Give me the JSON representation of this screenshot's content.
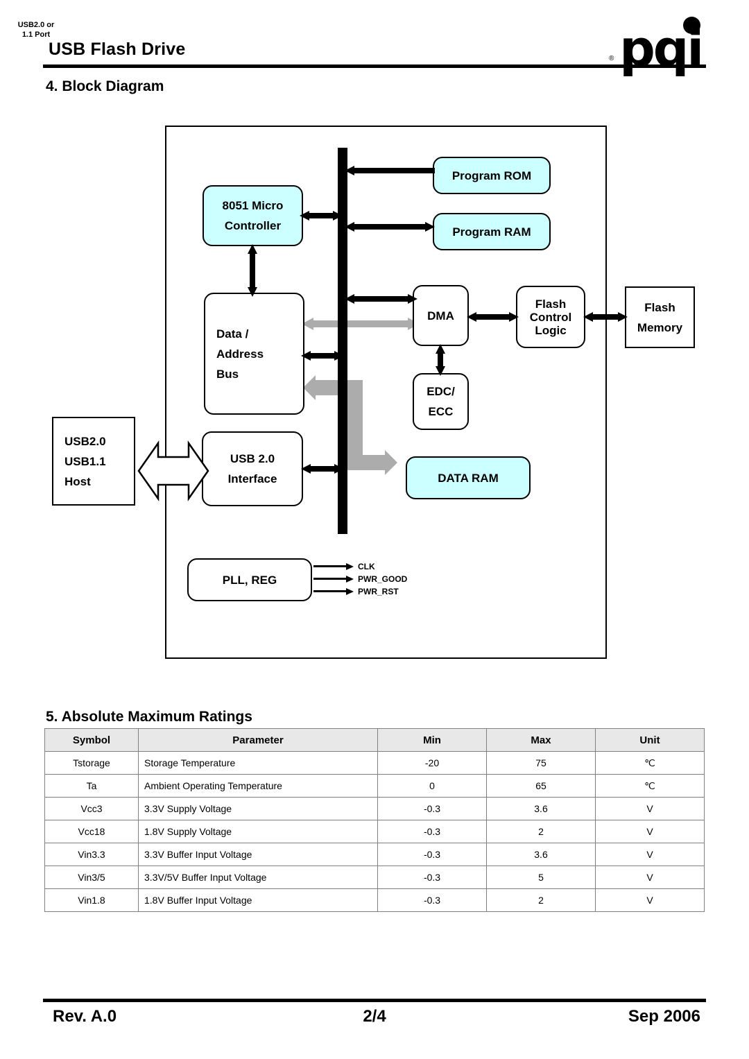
{
  "header": {
    "title": "USB Flash Drive",
    "logo_text": "pqi",
    "logo_registered": "®"
  },
  "sections": {
    "block_diagram_heading": "4. Block Diagram",
    "ratings_heading": "5. Absolute Maximum Ratings"
  },
  "colors": {
    "memory_block_fill": "#CCFFFF",
    "logic_block_fill": "#FFFFFF",
    "bus_color": "#000000",
    "gray_arrow": "#ACACAC",
    "table_header_fill": "#E8E8E8",
    "table_border": "#808080"
  },
  "diagram": {
    "nodes": {
      "microcontroller_l1": "8051 Micro",
      "microcontroller_l2": "Controller",
      "program_rom": "Program ROM",
      "program_ram": "Program RAM",
      "data_bus_l1": "Data /",
      "data_bus_l2": "Address",
      "data_bus_l3": "Bus",
      "dma": "DMA",
      "edc_l1": "EDC/",
      "edc_l2": "ECC",
      "flash_control_l1": "Flash",
      "flash_control_l2": "Control",
      "flash_control_l3": "Logic",
      "flash_memory_l1": "Flash",
      "flash_memory_l2": "Memory",
      "host_l1": "USB2.0",
      "host_l2": "USB1.1",
      "host_l3": "Host",
      "usb_interface_l1": "USB 2.0",
      "usb_interface_l2": "Interface",
      "data_ram": "DATA RAM",
      "pll_reg": "PLL, REG"
    },
    "usb_port_label_l1": "USB2.0 or",
    "usb_port_label_l2": "1.1 Port",
    "signals": [
      "CLK",
      "PWR_GOOD",
      "PWR_RST"
    ]
  },
  "ratings_table": {
    "columns": [
      "Symbol",
      "Parameter",
      "Min",
      "Max",
      "Unit"
    ],
    "rows": [
      {
        "symbol": "Tstorage",
        "parameter": "Storage Temperature",
        "min": "-20",
        "max": "75",
        "unit": "℃"
      },
      {
        "symbol": "Ta",
        "parameter": "Ambient Operating Temperature",
        "min": "0",
        "max": "65",
        "unit": "℃"
      },
      {
        "symbol": "Vcc3",
        "parameter": "3.3V Supply Voltage",
        "min": "-0.3",
        "max": "3.6",
        "unit": "V"
      },
      {
        "symbol": "Vcc18",
        "parameter": "1.8V Supply Voltage",
        "min": "-0.3",
        "max": "2",
        "unit": "V"
      },
      {
        "symbol": "Vin3.3",
        "parameter": "3.3V Buffer Input Voltage",
        "min": "-0.3",
        "max": "3.6",
        "unit": "V"
      },
      {
        "symbol": "Vin3/5",
        "parameter": "3.3V/5V Buffer Input Voltage",
        "min": "-0.3",
        "max": "5",
        "unit": "V"
      },
      {
        "symbol": "Vin1.8",
        "parameter": "1.8V Buffer Input Voltage",
        "min": "-0.3",
        "max": "2",
        "unit": "V"
      }
    ]
  },
  "footer": {
    "revision": "Rev. A.0",
    "page": "2/4",
    "date": "Sep 2006"
  }
}
